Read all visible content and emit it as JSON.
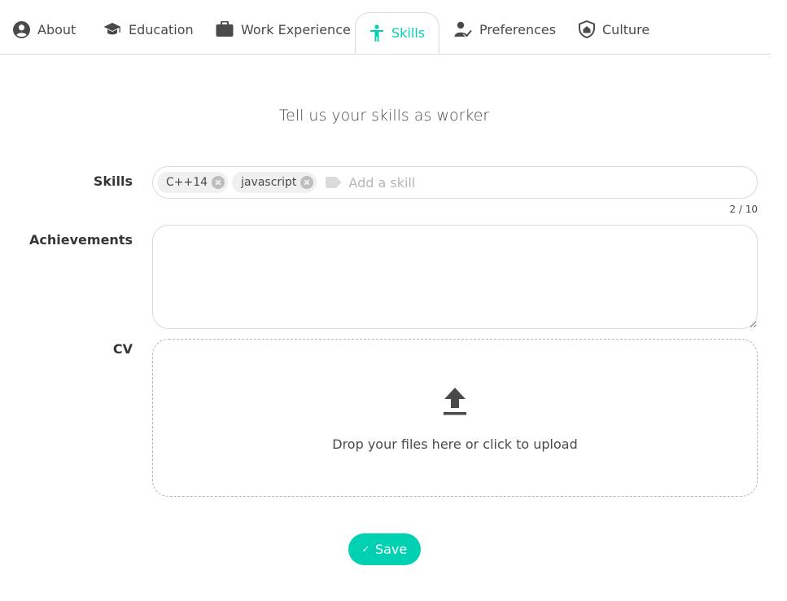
{
  "tabs": [
    {
      "label": "About",
      "icon": "user-circle-icon"
    },
    {
      "label": "Education",
      "icon": "graduation-cap-icon"
    },
    {
      "label": "Work Experience",
      "icon": "briefcase-icon"
    },
    {
      "label": "Skills",
      "icon": "accessibility-person-icon",
      "active": true
    },
    {
      "label": "Preferences",
      "icon": "user-check-icon"
    },
    {
      "label": "Culture",
      "icon": "shield-home-icon"
    }
  ],
  "heading": "Tell us your skills as worker",
  "form": {
    "skills": {
      "label": "Skills",
      "tags": [
        "C++14",
        "javascript"
      ],
      "placeholder": "Add a skill",
      "counter": "2 / 10"
    },
    "achievements": {
      "label": "Achievements",
      "value": ""
    },
    "cv": {
      "label": "CV",
      "drop_text": "Drop your files here or click to upload",
      "icon": "upload-icon"
    }
  },
  "save_button": {
    "label": "Save",
    "icon": "check-icon"
  },
  "colors": {
    "accent": "#00d1b2",
    "text": "#363636",
    "border": "#dbdbdb"
  }
}
